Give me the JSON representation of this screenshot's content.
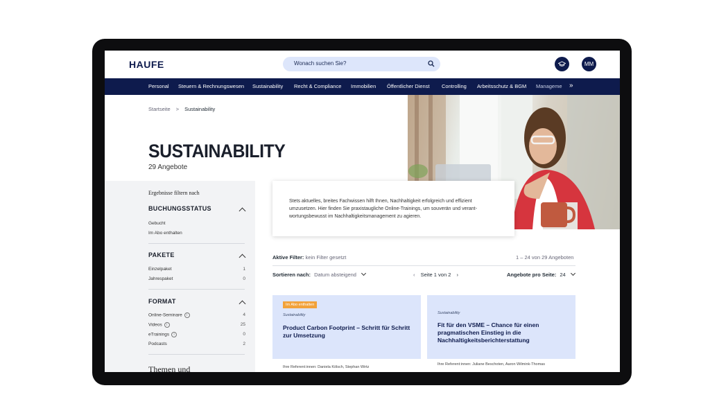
{
  "header": {
    "logo": "HAUFE",
    "search_placeholder": "Wonach suchen Sie?",
    "user_initials": "MM"
  },
  "nav": {
    "items": [
      "Personal",
      "Steuern & Rechnungswesen",
      "Sustainability",
      "Recht & Compliance",
      "Immobilien",
      "Öffentlicher Dienst",
      "Controlling",
      "Arbeitsschutz & BGM",
      "Manageme"
    ]
  },
  "breadcrumb": {
    "home": "Startseite",
    "current": "Sustainability"
  },
  "hero": {
    "title": "SUSTAINABILITY",
    "count": "29 Angebote"
  },
  "sidebar": {
    "heading": "Ergebnisse filtern nach",
    "sections": [
      {
        "title": "BUCHUNGSSTATUS",
        "options": [
          {
            "label": "Gebucht",
            "count": ""
          },
          {
            "label": "Im Abo enthalten",
            "count": ""
          }
        ]
      },
      {
        "title": "PAKETE",
        "options": [
          {
            "label": "Einzelpaket",
            "count": "1"
          },
          {
            "label": "Jahrespaket",
            "count": "0"
          }
        ]
      },
      {
        "title": "FORMAT",
        "options": [
          {
            "label": "Online-Seminare",
            "count": "4"
          },
          {
            "label": "Videos",
            "count": "25"
          },
          {
            "label": "eTrainings",
            "count": "0"
          },
          {
            "label": "Podcasts",
            "count": "2"
          }
        ]
      }
    ],
    "more_heading": "Themen und"
  },
  "description": "Stets aktuelles, breites Fachwissen hilft Ihnen, Nachhaltigkeit erfolgreich und effizient umzusetzen. Hier finden Sie praxistaugliche Online-Trainings, um souverän und verant-wortungsbewusst im Nachhaltigkeitsmanagement zu agieren.",
  "filters": {
    "active_label": "Aktive Filter:",
    "active_value": "kein Filter gesetzt",
    "range": "1 – 24 von 29 Angeboten",
    "sort_label": "Sortieren nach:",
    "sort_value": "Datum absteigend",
    "page": "Seite 1 von 2",
    "per_page_label": "Angebote pro Seite:",
    "per_page_value": "24"
  },
  "cards": [
    {
      "badge": "Im Abo enthalten",
      "category": "Sustainability",
      "title": "Product Carbon Footprint – Schritt für Schritt zur Umsetzung",
      "referent": "Ihre Referent:innen: Daniela Kölsch, Stephan Wirtz"
    },
    {
      "badge": "",
      "category": "Sustainability",
      "title": "Fit für den VSME – Chance für einen pragmatischen Einstieg in die Nachhaltigkeitsberichterstattung",
      "referent": "Ihre Referent:innen: Juliane Beschoten, Aaron Wilmink-Thomas"
    }
  ],
  "colors": {
    "brand_navy": "#0e1b4d",
    "card_blue": "#dce5fb",
    "badge_orange": "#f2a23a"
  }
}
